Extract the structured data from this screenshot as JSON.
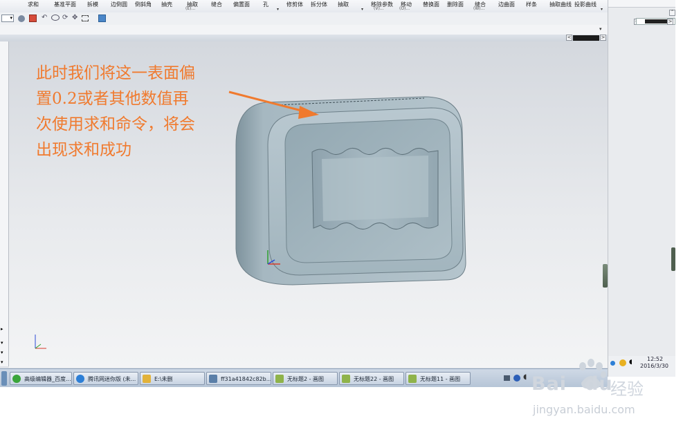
{
  "ribbon": {
    "tools": [
      {
        "label": "求和",
        "sub": ""
      },
      {
        "label": "基准平面",
        "sub": ""
      },
      {
        "label": "拆模",
        "sub": ""
      },
      {
        "label": "边倒圆",
        "sub": ""
      },
      {
        "label": "倒斜角",
        "sub": ""
      },
      {
        "label": "抽壳",
        "sub": ""
      },
      {
        "label": "抽取",
        "sub": "(E)..."
      },
      {
        "label": "缝合",
        "sub": ""
      },
      {
        "label": "偏置面",
        "sub": ""
      },
      {
        "label": "孔",
        "sub": ""
      },
      {
        "label": "修剪体",
        "sub": ""
      },
      {
        "label": "拆分体",
        "sub": ""
      },
      {
        "label": "抽取",
        "sub": ""
      },
      {
        "label": "移除参数",
        "sub": "(V)..."
      },
      {
        "label": "移动",
        "sub": "(O)..."
      },
      {
        "label": "替换面",
        "sub": ""
      },
      {
        "label": "删除面",
        "sub": ""
      },
      {
        "label": "缝合",
        "sub": "(W)..."
      },
      {
        "label": "边曲面",
        "sub": ""
      },
      {
        "label": "样条",
        "sub": ""
      },
      {
        "label": "抽取曲线",
        "sub": ""
      },
      {
        "label": "投影曲线",
        "sub": ""
      }
    ]
  },
  "annotation": {
    "lines": [
      "此时我们将这一表面偏",
      "置0.2或者其他数值再",
      "次使用求和命令，将会",
      "出现求和成功"
    ],
    "color": "#f07a2e"
  },
  "taskbar": {
    "items": [
      {
        "label": "高级编辑器_百度...",
        "icon_color": "#3aa53a"
      },
      {
        "label": "腾讯网迷你版 (未...",
        "icon_color": "#2d7fd6"
      },
      {
        "label": "E:\\未删",
        "icon_color": "#e2b23a"
      },
      {
        "label": "ff31a41842c82b...",
        "icon_color": "#5b7fa8"
      },
      {
        "label": "无标题2 - 画图",
        "icon_color": "#8fb34a"
      },
      {
        "label": "无标题22 - 画图",
        "icon_color": "#8fb34a"
      },
      {
        "label": "无标题11 - 画图",
        "icon_color": "#8fb34a"
      }
    ]
  },
  "tray": {
    "time": "12:52",
    "date": "2016/3/30"
  },
  "watermark": {
    "brand": "Bai",
    "brand2": "du",
    "cn": "经验",
    "url": "jingyan.baidu.com"
  },
  "colors": {
    "model": "#9fb3bd",
    "accent": "#f07a2e"
  }
}
